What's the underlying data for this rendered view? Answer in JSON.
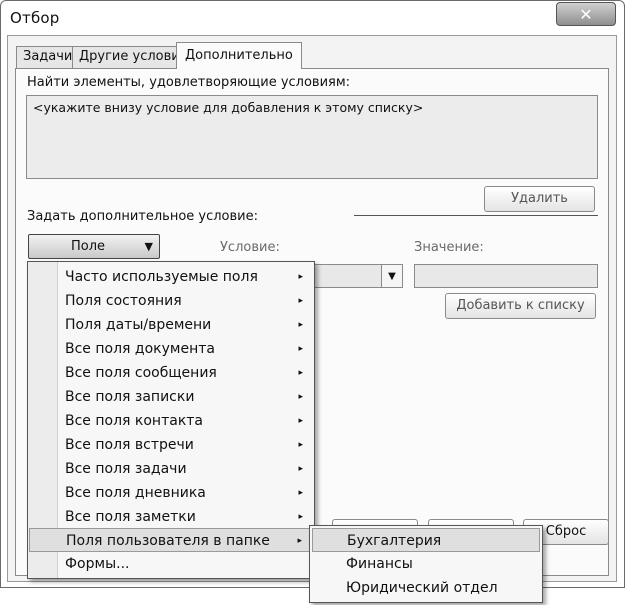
{
  "window": {
    "title": "Отбор",
    "close_label": "✕"
  },
  "tabs": [
    {
      "label": "Задачи"
    },
    {
      "label": "Другие условия"
    },
    {
      "label": "Дополнительно",
      "active": true
    }
  ],
  "advanced": {
    "find_label": "Найти элементы, удовлетворяющие условиям:",
    "criteria_placeholder": "<укажите внизу условие для добавления к этому списку>",
    "delete_label": "Удалить",
    "define_label": "Задать дополнительное условие:",
    "field_button_label": "Поле",
    "condition_label": "Условие:",
    "value_label": "Значение:",
    "add_to_list_label": "Добавить к списку"
  },
  "footer": {
    "reset_label": "Сброс"
  },
  "field_menu": {
    "items": [
      {
        "label": "Часто используемые поля",
        "submenu": true
      },
      {
        "label": "Поля состояния",
        "submenu": true
      },
      {
        "label": "Поля даты/времени",
        "submenu": true
      },
      {
        "label": "Все поля документа",
        "submenu": true
      },
      {
        "label": "Все поля сообщения",
        "submenu": true
      },
      {
        "label": "Все поля записки",
        "submenu": true
      },
      {
        "label": "Все поля контакта",
        "submenu": true
      },
      {
        "label": "Все поля встречи",
        "submenu": true
      },
      {
        "label": "Все поля задачи",
        "submenu": true
      },
      {
        "label": "Все поля дневника",
        "submenu": true
      },
      {
        "label": "Все поля заметки",
        "submenu": true
      },
      {
        "label": "Поля пользователя в папке",
        "submenu": true,
        "highlighted": true
      },
      {
        "label": "Формы...",
        "submenu": false
      }
    ]
  },
  "sub_menu": {
    "items": [
      {
        "label": "Бухгалтерия",
        "highlighted": true
      },
      {
        "label": "Финансы"
      },
      {
        "label": "Юридический отдел"
      }
    ]
  },
  "icons": {
    "submenu_arrow": "▸",
    "dropdown_arrow": "▼"
  }
}
